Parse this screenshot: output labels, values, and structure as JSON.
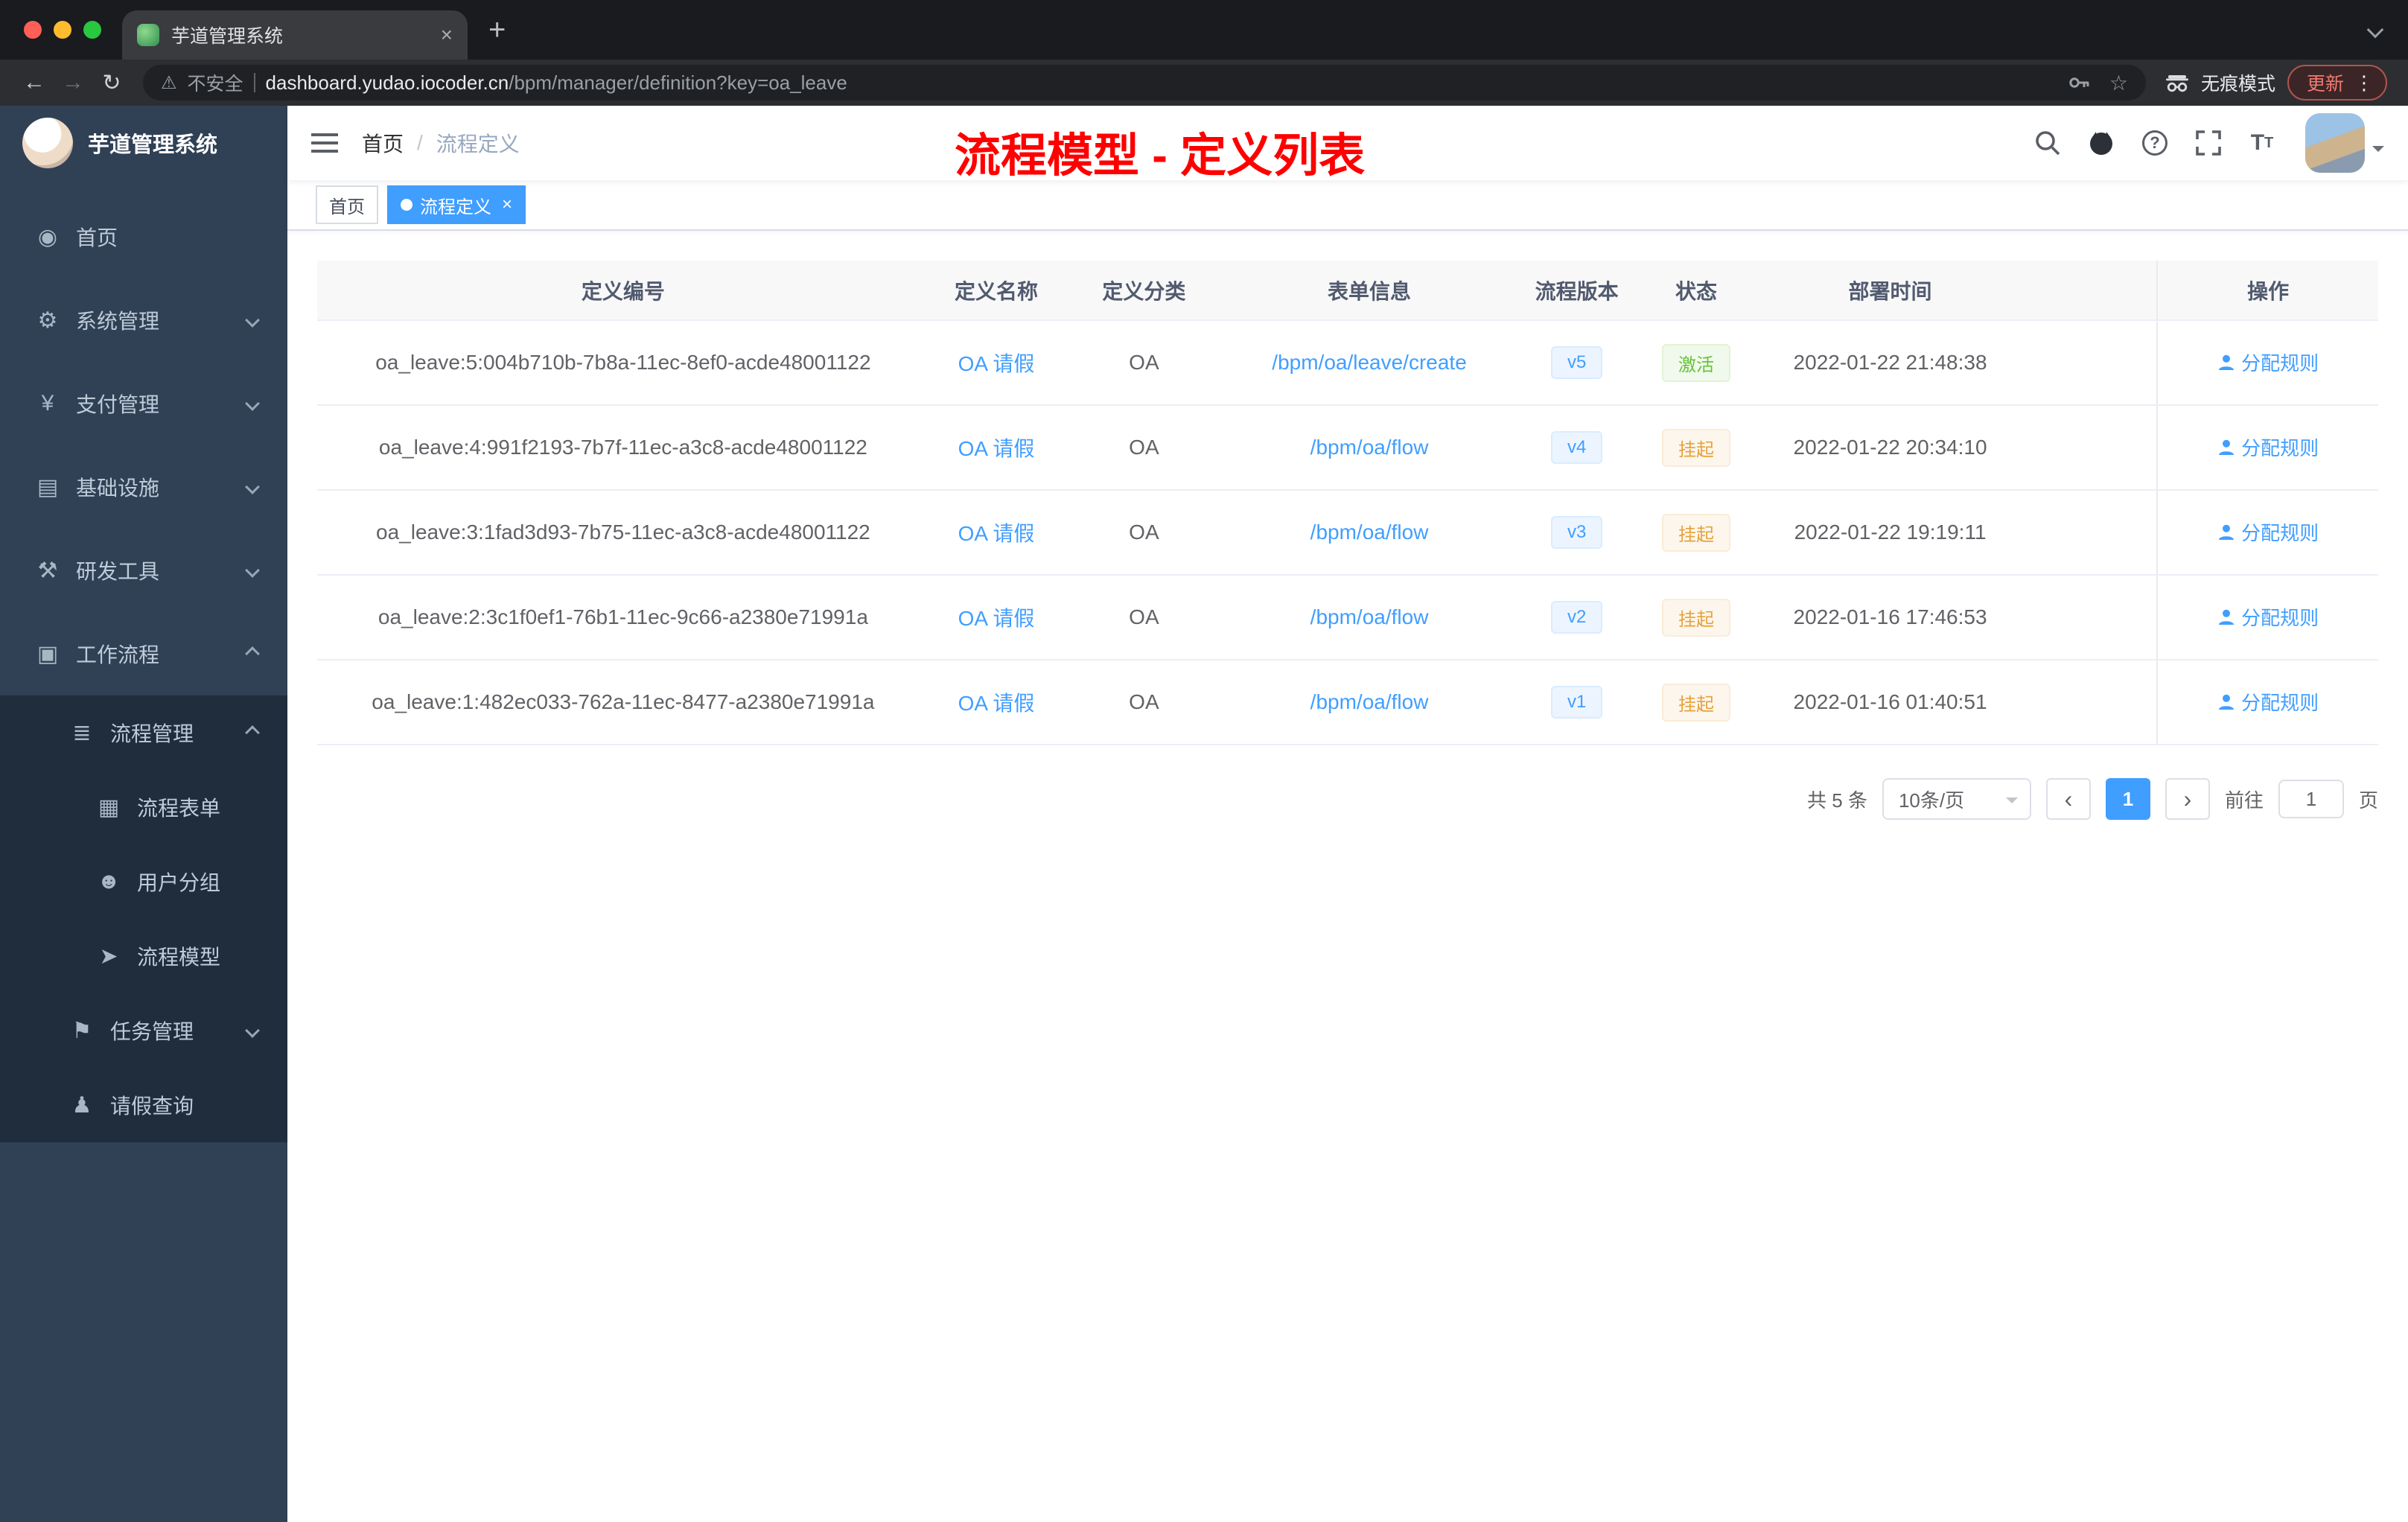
{
  "colors": {
    "accent": "#409eff",
    "success": "#67c23a",
    "warning": "#e6a23c",
    "annotation": "#ff0000",
    "sidebar_bg": "#304156",
    "submenu_bg": "#1f2d3d"
  },
  "icons": {
    "dashboard": "◉",
    "gear": "⚙",
    "yen": "¥",
    "infra": "▤",
    "tools": "⚒",
    "workflow": "▣",
    "process": "≣",
    "form": "▦",
    "group": "☻",
    "model": "➤",
    "task": "⚑",
    "user": "♟",
    "back": "←",
    "forward": "→",
    "reload": "↻",
    "warning": "⚠",
    "star": "☆",
    "dots": "⋮",
    "plus": "+",
    "close": "×",
    "question": "?",
    "font": "T"
  },
  "browser": {
    "tab_title": "芋道管理系统",
    "security": "不安全",
    "url_host": "dashboard.yudao.iocoder.cn",
    "url_path": "/bpm/manager/definition?key=oa_leave",
    "incognito": "无痕模式",
    "update": "更新"
  },
  "sidebar": {
    "title": "芋道管理系统",
    "menu": [
      {
        "label": "首页",
        "icon": "dashboard"
      },
      {
        "label": "系统管理",
        "icon": "gear"
      },
      {
        "label": "支付管理",
        "icon": "yen"
      },
      {
        "label": "基础设施",
        "icon": "infra"
      },
      {
        "label": "研发工具",
        "icon": "tools"
      },
      {
        "label": "工作流程",
        "icon": "workflow"
      },
      {
        "label": "流程管理",
        "icon": "process"
      },
      {
        "label": "流程表单",
        "icon": "form"
      },
      {
        "label": "用户分组",
        "icon": "group"
      },
      {
        "label": "流程模型",
        "icon": "model"
      },
      {
        "label": "任务管理",
        "icon": "task"
      },
      {
        "label": "请假查询",
        "icon": "user"
      }
    ]
  },
  "header": {
    "breadcrumb_home": "首页",
    "breadcrumb_sep": "/",
    "breadcrumb_current": "流程定义",
    "annotation": "流程模型 - 定义列表"
  },
  "tags": [
    {
      "label": "首页"
    },
    {
      "label": "流程定义"
    }
  ],
  "table": {
    "columns": [
      "定义编号",
      "定义名称",
      "定义分类",
      "表单信息",
      "流程版本",
      "状态",
      "部署时间",
      "操作"
    ],
    "rows": [
      {
        "id": "oa_leave:5:004b710b-7b8a-11ec-8ef0-acde48001122",
        "name": "OA 请假",
        "category": "OA",
        "form": "/bpm/oa/leave/create",
        "version": "v5",
        "status": "激活",
        "status_type": "success",
        "time": "2022-01-22 21:48:38",
        "op": "分配规则"
      },
      {
        "id": "oa_leave:4:991f2193-7b7f-11ec-a3c8-acde48001122",
        "name": "OA 请假",
        "category": "OA",
        "form": "/bpm/oa/flow",
        "version": "v4",
        "status": "挂起",
        "status_type": "warning",
        "time": "2022-01-22 20:34:10",
        "op": "分配规则"
      },
      {
        "id": "oa_leave:3:1fad3d93-7b75-11ec-a3c8-acde48001122",
        "name": "OA 请假",
        "category": "OA",
        "form": "/bpm/oa/flow",
        "version": "v3",
        "status": "挂起",
        "status_type": "warning",
        "time": "2022-01-22 19:19:11",
        "op": "分配规则"
      },
      {
        "id": "oa_leave:2:3c1f0ef1-76b1-11ec-9c66-a2380e71991a",
        "name": "OA 请假",
        "category": "OA",
        "form": "/bpm/oa/flow",
        "version": "v2",
        "status": "挂起",
        "status_type": "warning",
        "time": "2022-01-16 17:46:53",
        "op": "分配规则"
      },
      {
        "id": "oa_leave:1:482ec033-762a-11ec-8477-a2380e71991a",
        "name": "OA 请假",
        "category": "OA",
        "form": "/bpm/oa/flow",
        "version": "v1",
        "status": "挂起",
        "status_type": "warning",
        "time": "2022-01-16 01:40:51",
        "op": "分配规则"
      }
    ]
  },
  "pagination": {
    "total": "共 5 条",
    "page_size": "10条/页",
    "current": "1",
    "goto_label": "前往",
    "goto_value": "1",
    "page_label": "页"
  }
}
